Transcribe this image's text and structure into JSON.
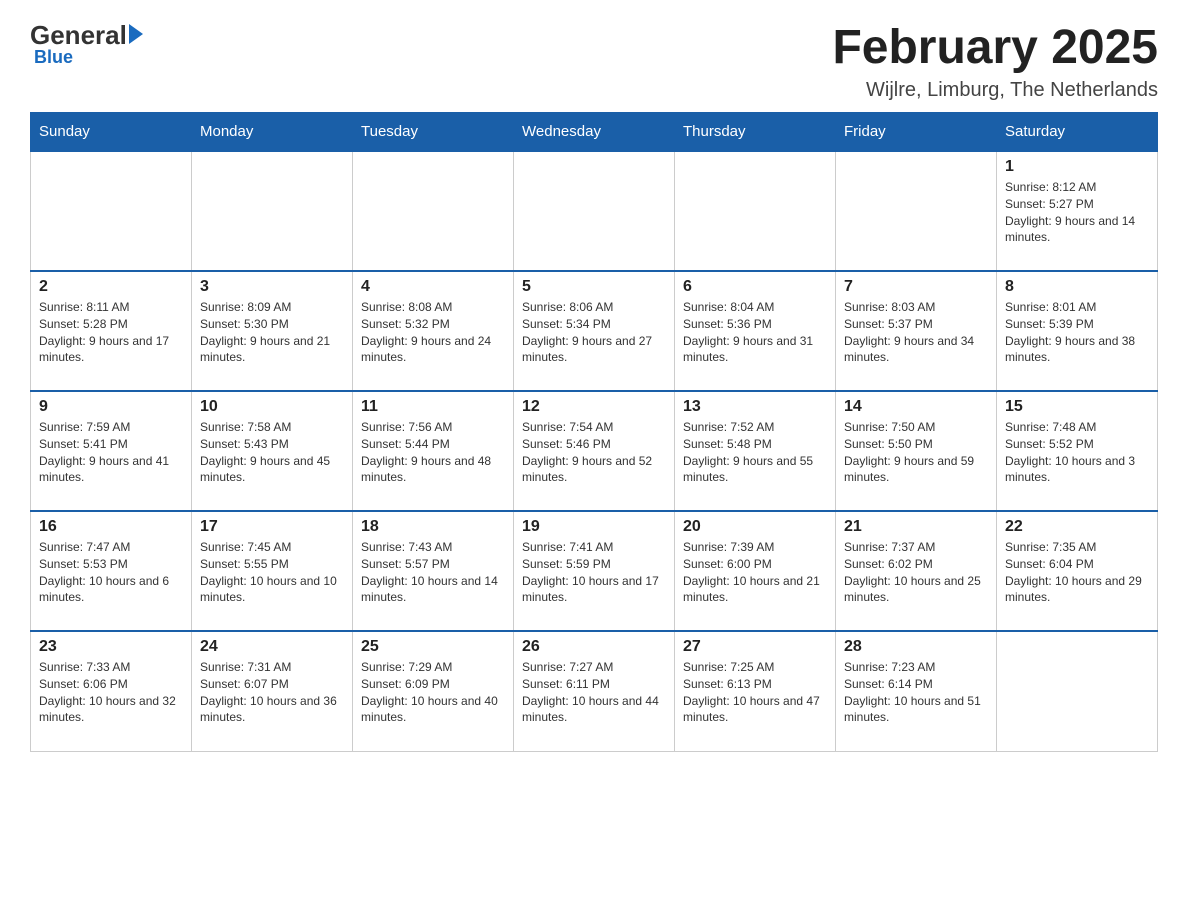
{
  "logo": {
    "general": "General",
    "blue": "Blue"
  },
  "title": "February 2025",
  "subtitle": "Wijlre, Limburg, The Netherlands",
  "days_of_week": [
    "Sunday",
    "Monday",
    "Tuesday",
    "Wednesday",
    "Thursday",
    "Friday",
    "Saturday"
  ],
  "weeks": [
    [
      {
        "day": "",
        "info": ""
      },
      {
        "day": "",
        "info": ""
      },
      {
        "day": "",
        "info": ""
      },
      {
        "day": "",
        "info": ""
      },
      {
        "day": "",
        "info": ""
      },
      {
        "day": "",
        "info": ""
      },
      {
        "day": "1",
        "info": "Sunrise: 8:12 AM\nSunset: 5:27 PM\nDaylight: 9 hours and 14 minutes."
      }
    ],
    [
      {
        "day": "2",
        "info": "Sunrise: 8:11 AM\nSunset: 5:28 PM\nDaylight: 9 hours and 17 minutes."
      },
      {
        "day": "3",
        "info": "Sunrise: 8:09 AM\nSunset: 5:30 PM\nDaylight: 9 hours and 21 minutes."
      },
      {
        "day": "4",
        "info": "Sunrise: 8:08 AM\nSunset: 5:32 PM\nDaylight: 9 hours and 24 minutes."
      },
      {
        "day": "5",
        "info": "Sunrise: 8:06 AM\nSunset: 5:34 PM\nDaylight: 9 hours and 27 minutes."
      },
      {
        "day": "6",
        "info": "Sunrise: 8:04 AM\nSunset: 5:36 PM\nDaylight: 9 hours and 31 minutes."
      },
      {
        "day": "7",
        "info": "Sunrise: 8:03 AM\nSunset: 5:37 PM\nDaylight: 9 hours and 34 minutes."
      },
      {
        "day": "8",
        "info": "Sunrise: 8:01 AM\nSunset: 5:39 PM\nDaylight: 9 hours and 38 minutes."
      }
    ],
    [
      {
        "day": "9",
        "info": "Sunrise: 7:59 AM\nSunset: 5:41 PM\nDaylight: 9 hours and 41 minutes."
      },
      {
        "day": "10",
        "info": "Sunrise: 7:58 AM\nSunset: 5:43 PM\nDaylight: 9 hours and 45 minutes."
      },
      {
        "day": "11",
        "info": "Sunrise: 7:56 AM\nSunset: 5:44 PM\nDaylight: 9 hours and 48 minutes."
      },
      {
        "day": "12",
        "info": "Sunrise: 7:54 AM\nSunset: 5:46 PM\nDaylight: 9 hours and 52 minutes."
      },
      {
        "day": "13",
        "info": "Sunrise: 7:52 AM\nSunset: 5:48 PM\nDaylight: 9 hours and 55 minutes."
      },
      {
        "day": "14",
        "info": "Sunrise: 7:50 AM\nSunset: 5:50 PM\nDaylight: 9 hours and 59 minutes."
      },
      {
        "day": "15",
        "info": "Sunrise: 7:48 AM\nSunset: 5:52 PM\nDaylight: 10 hours and 3 minutes."
      }
    ],
    [
      {
        "day": "16",
        "info": "Sunrise: 7:47 AM\nSunset: 5:53 PM\nDaylight: 10 hours and 6 minutes."
      },
      {
        "day": "17",
        "info": "Sunrise: 7:45 AM\nSunset: 5:55 PM\nDaylight: 10 hours and 10 minutes."
      },
      {
        "day": "18",
        "info": "Sunrise: 7:43 AM\nSunset: 5:57 PM\nDaylight: 10 hours and 14 minutes."
      },
      {
        "day": "19",
        "info": "Sunrise: 7:41 AM\nSunset: 5:59 PM\nDaylight: 10 hours and 17 minutes."
      },
      {
        "day": "20",
        "info": "Sunrise: 7:39 AM\nSunset: 6:00 PM\nDaylight: 10 hours and 21 minutes."
      },
      {
        "day": "21",
        "info": "Sunrise: 7:37 AM\nSunset: 6:02 PM\nDaylight: 10 hours and 25 minutes."
      },
      {
        "day": "22",
        "info": "Sunrise: 7:35 AM\nSunset: 6:04 PM\nDaylight: 10 hours and 29 minutes."
      }
    ],
    [
      {
        "day": "23",
        "info": "Sunrise: 7:33 AM\nSunset: 6:06 PM\nDaylight: 10 hours and 32 minutes."
      },
      {
        "day": "24",
        "info": "Sunrise: 7:31 AM\nSunset: 6:07 PM\nDaylight: 10 hours and 36 minutes."
      },
      {
        "day": "25",
        "info": "Sunrise: 7:29 AM\nSunset: 6:09 PM\nDaylight: 10 hours and 40 minutes."
      },
      {
        "day": "26",
        "info": "Sunrise: 7:27 AM\nSunset: 6:11 PM\nDaylight: 10 hours and 44 minutes."
      },
      {
        "day": "27",
        "info": "Sunrise: 7:25 AM\nSunset: 6:13 PM\nDaylight: 10 hours and 47 minutes."
      },
      {
        "day": "28",
        "info": "Sunrise: 7:23 AM\nSunset: 6:14 PM\nDaylight: 10 hours and 51 minutes."
      },
      {
        "day": "",
        "info": ""
      }
    ]
  ]
}
